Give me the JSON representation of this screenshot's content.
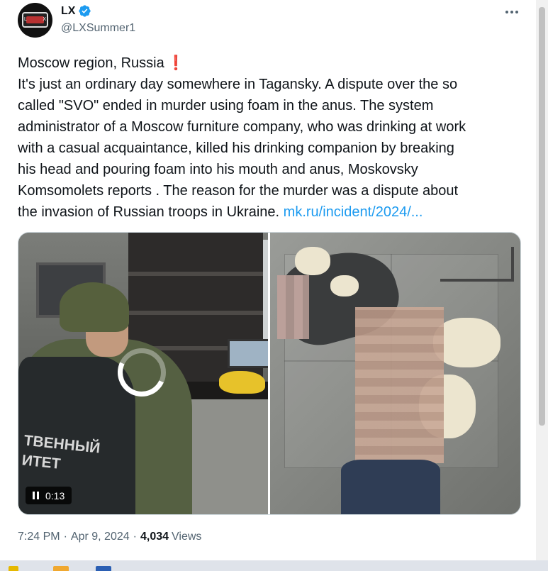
{
  "author": {
    "display_name": "LX",
    "handle": "@LXSummer1",
    "avatar_icon": "lx-logo-avatar",
    "verified": true
  },
  "tweet": {
    "lines": [
      "Moscow region, Russia",
      "It's just an ordinary day somewhere in Tagansky. A dispute over the so",
      "called \"SVO\" ended in murder using foam in the anus. The system",
      "administrator of a Moscow furniture company, who was drinking at work",
      "with a casual acquaintance, killed his drinking companion by breaking",
      "his head and pouring foam into his mouth and anus, Moskovsky",
      "Komsomolets reports . The reason for the murder was a dispute about",
      "the invasion of Russian troops in Ukraine."
    ],
    "emoji": "❗",
    "link_text": "mk.ru/incident/2024/..."
  },
  "media": {
    "left_video_text": "ТВЕННЫЙ\nИТЕТ",
    "video_time": "0:13"
  },
  "meta": {
    "time": "7:24 PM",
    "separator": "·",
    "date": "Apr 9, 2024",
    "views_count": "4,034",
    "views_label": "Views"
  },
  "colors": {
    "link": "#1d9bf0",
    "verified": "#1d9bf0",
    "secondary_text": "#536471",
    "emoji": "#e0245e"
  }
}
